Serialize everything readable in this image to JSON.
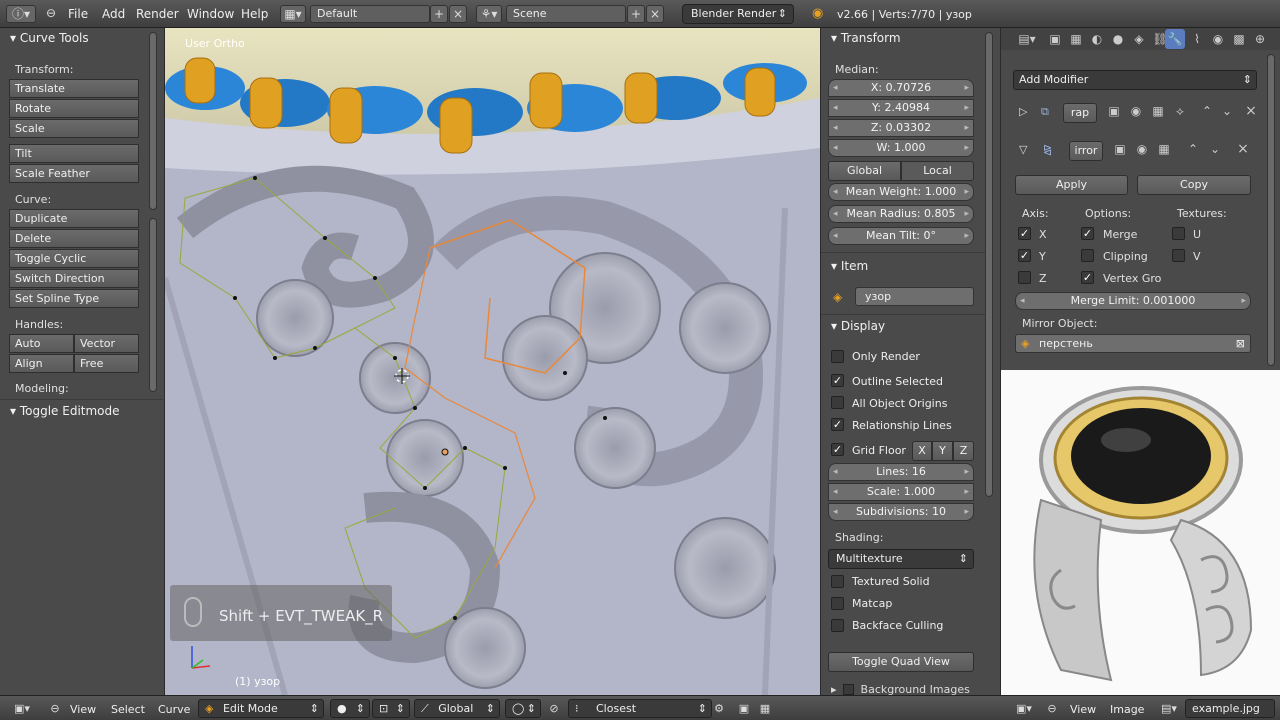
{
  "topbar": {
    "menus": [
      "File",
      "Add",
      "Render",
      "Window",
      "Help"
    ],
    "layout": "Default",
    "scene": "Scene",
    "engine": "Blender Render",
    "stats": "v2.66 | Verts:7/70 | узор"
  },
  "toolshelf": {
    "title": "Curve Tools",
    "transform_label": "Transform:",
    "transform": [
      "Translate",
      "Rotate",
      "Scale"
    ],
    "tilt": [
      "Tilt",
      "Scale Feather"
    ],
    "curve_label": "Curve:",
    "curve": [
      "Duplicate",
      "Delete",
      "Toggle Cyclic",
      "Switch Direction",
      "Set Spline Type"
    ],
    "handles_label": "Handles:",
    "handles": [
      "Auto",
      "Vector",
      "Align",
      "Free"
    ],
    "modeling_label": "Modeling:",
    "toggle_editmode": "Toggle Editmode"
  },
  "viewport": {
    "view_name": "User Ortho",
    "object_info": "(1) узор",
    "toast": "Shift + EVT_TWEAK_R"
  },
  "npanel": {
    "transform": {
      "title": "Transform",
      "median_label": "Median:",
      "x": "X: 0.70726",
      "y": "Y: 2.40984",
      "z": "Z: 0.03302",
      "w": "W: 1.000",
      "global": "Global",
      "local": "Local",
      "mean_weight": "Mean Weight: 1.000",
      "mean_radius": "Mean Radius: 0.805",
      "mean_tilt": "Mean Tilt: 0°"
    },
    "item": {
      "title": "Item",
      "name": "узор"
    },
    "display": {
      "title": "Display",
      "only_render": "Only Render",
      "outline_selected": "Outline Selected",
      "all_object_origins": "All Object Origins",
      "relationship_lines": "Relationship Lines",
      "grid_floor": "Grid Floor",
      "axis_x": "X",
      "axis_y": "Y",
      "axis_z": "Z",
      "lines": "Lines: 16",
      "scale": "Scale: 1.000",
      "subdivisions": "Subdivisions: 10",
      "shading_label": "Shading:",
      "shading_mode": "Multitexture",
      "textured_solid": "Textured Solid",
      "matcap": "Matcap",
      "backface_culling": "Backface Culling",
      "toggle_quad_view": "Toggle Quad View",
      "background_images": "Background Images"
    }
  },
  "modifiers": {
    "add_modifier": "Add Modifier",
    "mod1_name": "rap",
    "mod2_name": "irror",
    "apply": "Apply",
    "copy": "Copy",
    "axis_label": "Axis:",
    "options_label": "Options:",
    "textures_label": "Textures:",
    "x": "X",
    "y": "Y",
    "z": "Z",
    "merge": "Merge",
    "clipping": "Clipping",
    "vertex_groups": "Vertex Gro",
    "u": "U",
    "v": "V",
    "merge_limit": "Merge Limit: 0.001000",
    "mirror_object_label": "Mirror Object:",
    "mirror_object": "перстень"
  },
  "bottombar": {
    "view": "View",
    "select": "Select",
    "curve": "Curve",
    "mode": "Edit Mode",
    "orientation": "Global",
    "snap": "Closest",
    "img_view": "View",
    "img_image": "Image",
    "img_name": "example.jpg"
  },
  "colors": {
    "selected_orange": "#e8883a",
    "wire_green": "#9aa83a",
    "gem_blue": "#2b86d8",
    "prong_gold": "#e8a020"
  }
}
